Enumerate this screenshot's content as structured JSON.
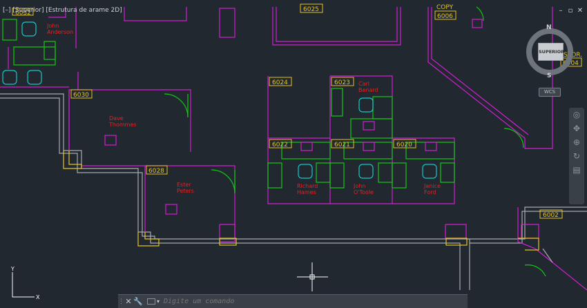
{
  "viewport": {
    "minus": "[–]",
    "view": "[Superior]",
    "style": "[Estrutura de arame 2D]"
  },
  "window_controls": {
    "min": "–",
    "restore": "▫",
    "close": "✕"
  },
  "viewcube": {
    "face": "SUPERIOR",
    "north": "N",
    "south": "S",
    "wcs": "WCS"
  },
  "rooms": {
    "r6025": "6025",
    "r6006": "6006",
    "r6030": "6030",
    "r6028": "6028",
    "r6024": "6024",
    "r6023": "6023",
    "r6022": "6022",
    "r6021": "6021",
    "r6020": "6020",
    "r6004": "6004",
    "r6002": "6002",
    "r6032": "6032"
  },
  "labels": {
    "copy": "COPY",
    "stor": "STOR."
  },
  "people": {
    "john_anderson": [
      "John",
      "Anderson"
    ],
    "dave_thommes": [
      "Dave",
      "Thommes"
    ],
    "ester_peters": [
      "Ester",
      "Peters"
    ],
    "carl_benard": [
      "Carl",
      "Benard"
    ],
    "richard_hames": [
      "Richard",
      "Hames"
    ],
    "john_otoole": [
      "John",
      "O'Toole"
    ],
    "janice_ford": [
      "Janice",
      "Ford"
    ]
  },
  "ucs": {
    "x": "X",
    "y": "Y"
  },
  "command": {
    "placeholder": "Digite um comando",
    "close": "✕",
    "settings": "🔧"
  },
  "colors": {
    "background": "#212830",
    "walls": "#d41fd4",
    "tags": "#e7c51d",
    "furniture": "#13c8c8",
    "desks": "#14c814",
    "doors": "#14c814",
    "names": "#e62222",
    "corridor": "#a8acb0"
  }
}
